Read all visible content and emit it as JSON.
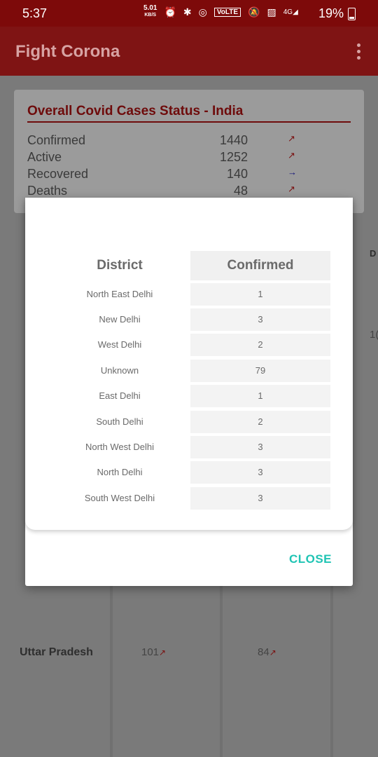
{
  "status_bar": {
    "time": "5:37",
    "speed_value": "5.01",
    "speed_unit": "KB/S",
    "volte": "VoLTE",
    "network": "4G",
    "battery": "19%"
  },
  "app_bar": {
    "title": "Fight Corona"
  },
  "overall": {
    "title": "Overall Covid Cases Status - India",
    "rows": [
      {
        "label": "Confirmed",
        "value": "1440",
        "trend": "up"
      },
      {
        "label": "Active",
        "value": "1252",
        "trend": "up"
      },
      {
        "label": "Recovered",
        "value": "140",
        "trend": "flat"
      },
      {
        "label": "Deaths",
        "value": "48",
        "trend": "up"
      }
    ]
  },
  "background_table": {
    "partial_header": "D",
    "partial_value": "1(",
    "row": {
      "state": "Uttar Pradesh",
      "confirmed": "101",
      "active": "84"
    }
  },
  "dialog": {
    "header_district": "District",
    "header_confirmed": "Confirmed",
    "rows": [
      {
        "district": "North East Delhi",
        "confirmed": "1"
      },
      {
        "district": "New Delhi",
        "confirmed": "3"
      },
      {
        "district": "West Delhi",
        "confirmed": "2"
      },
      {
        "district": "Unknown",
        "confirmed": "79"
      },
      {
        "district": "East Delhi",
        "confirmed": "1"
      },
      {
        "district": "South Delhi",
        "confirmed": "2"
      },
      {
        "district": "North West Delhi",
        "confirmed": "3"
      },
      {
        "district": "North Delhi",
        "confirmed": "3"
      },
      {
        "district": "South West Delhi",
        "confirmed": "3"
      }
    ],
    "close_label": "CLOSE"
  },
  "colors": {
    "primary": "#7f1414",
    "accent": "#1fc4b4",
    "trend_up": "#c62828",
    "trend_flat": "#1a237e"
  }
}
